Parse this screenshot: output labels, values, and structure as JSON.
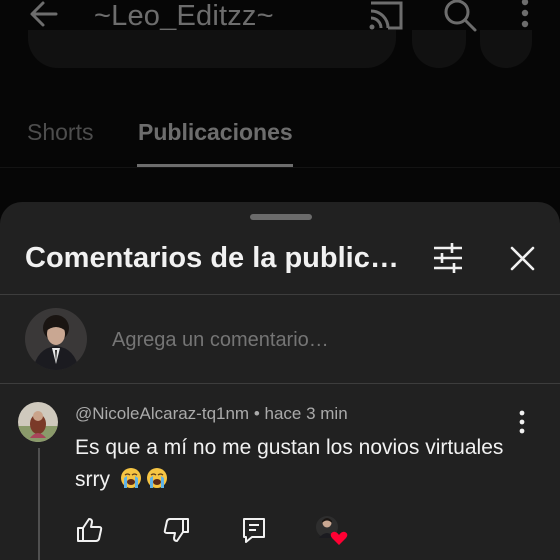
{
  "header": {
    "channel_name": "~Leo_Editzz~",
    "icons": [
      "back-arrow-icon",
      "cast-icon",
      "search-icon",
      "more-vertical-icon"
    ]
  },
  "tabs": [
    {
      "label": "Shorts",
      "selected": false
    },
    {
      "label": "Publicaciones",
      "selected": true
    }
  ],
  "sheet": {
    "title": "Comentarios de la public…",
    "icons": [
      "filter-icon",
      "close-icon"
    ],
    "composer": {
      "placeholder": "Agrega un comentario…"
    }
  },
  "comment": {
    "author": "@NicoleAlcaraz-tq1nm",
    "time": "hace 3 min",
    "meta_separator": " • ",
    "text": "Es que a mí no me gustan los novios virtuales srry",
    "emoji": [
      "loudly-crying-face-emoji",
      "loudly-crying-face-emoji"
    ],
    "actions": [
      "like-icon",
      "dislike-icon",
      "reply-icon",
      "creator-heart-icon"
    ]
  },
  "colors": {
    "background": "#0f0f0f",
    "sheet": "#212121",
    "text_primary": "#f1f1f1",
    "text_secondary": "#aaaaaa",
    "heart": "#ff0033"
  }
}
